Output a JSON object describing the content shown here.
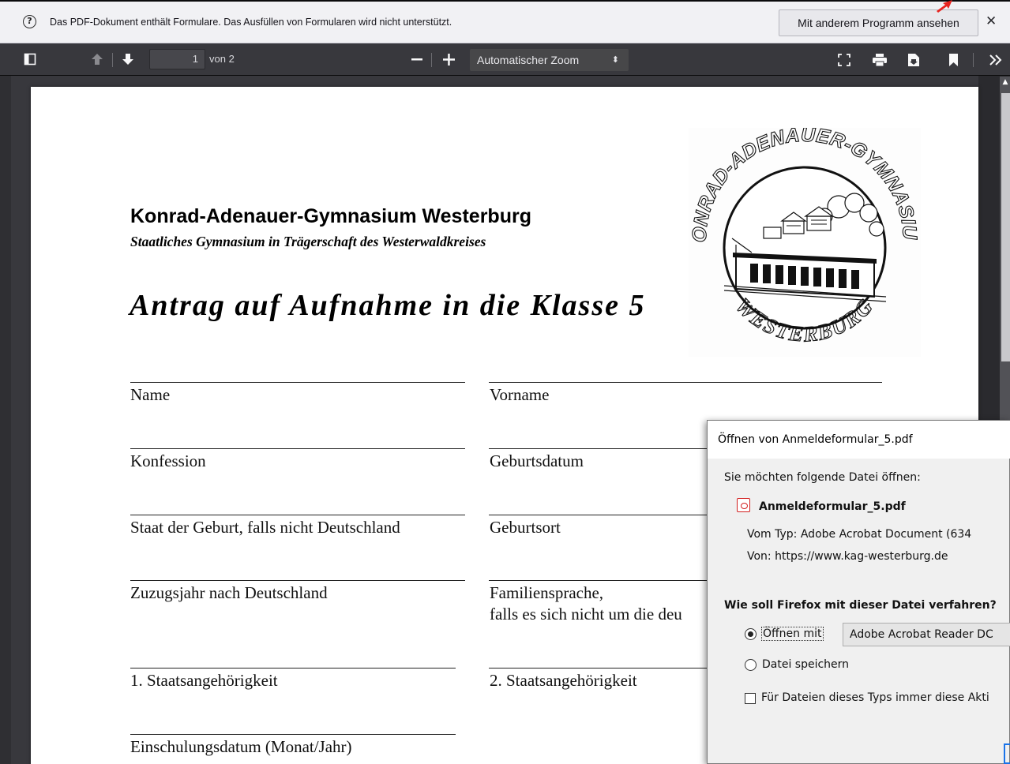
{
  "notification": {
    "message": "Das PDF-Dokument enthält Formulare. Das Ausfüllen von Formularen wird nicht unterstützt.",
    "button_label": "Mit anderem Programm ansehen",
    "help_icon": "question-circle-icon",
    "close_icon": "close-icon"
  },
  "toolbar": {
    "page_number": "1",
    "page_count": "von 2",
    "zoom_label": "Automatischer Zoom",
    "zoom_caret": "⬍",
    "icons": [
      "sidebar-toggle-icon",
      "previous-page-icon",
      "next-page-icon",
      "zoom-out-icon",
      "zoom-in-icon",
      "presentation-mode-icon",
      "print-icon",
      "download-icon",
      "bookmark-icon",
      "tools-icon"
    ]
  },
  "document": {
    "school_name": "Konrad-Adenauer-Gymnasium Westerburg",
    "school_subtitle": "Staatliches Gymnasium in Trägerschaft des Westerwaldkreises",
    "form_title": "Antrag auf Aufnahme in die Klasse 5",
    "logo_top_text": "KONRAD-ADENAUER-GYMNASIUM",
    "logo_bottom_text": "WESTERBURG",
    "fields_left": [
      "Name",
      "Konfession",
      "Staat der Geburt, falls nicht Deutschland",
      "Zuzugsjahr nach Deutschland",
      "1. Staatsangehörigkeit",
      "Einschulungsdatum (Monat/Jahr)"
    ],
    "fields_right": [
      "Vorname",
      "Geburtsdatum",
      "Geburtsort",
      "Familiensprache,",
      "falls es sich nicht um die deu",
      "2. Staatsangehörigkeit"
    ]
  },
  "dialog": {
    "title": "Öffnen von Anmeldeformular_5.pdf",
    "intro": "Sie möchten folgende Datei öffnen:",
    "filename": "Anmeldeformular_5.pdf",
    "type_line": "Vom Typ: Adobe Acrobat Document (634",
    "from_line": "Von: https://www.kag-westerburg.de",
    "question": "Wie soll Firefox mit dieser Datei verfahren?",
    "open_with_label": "Öffnen mit",
    "open_with_app": "Adobe Acrobat Reader DC",
    "save_label": "Datei speichern",
    "always_label": "Für Dateien dieses Typs immer diese Akti",
    "open_with_selected": true,
    "always_checked": false
  },
  "colors": {
    "toolbar_bg": "#38383d",
    "notification_bg": "#f1f1f4",
    "annotation_arrow": "#e8231f",
    "pdf_icon": "#d21f1f"
  }
}
